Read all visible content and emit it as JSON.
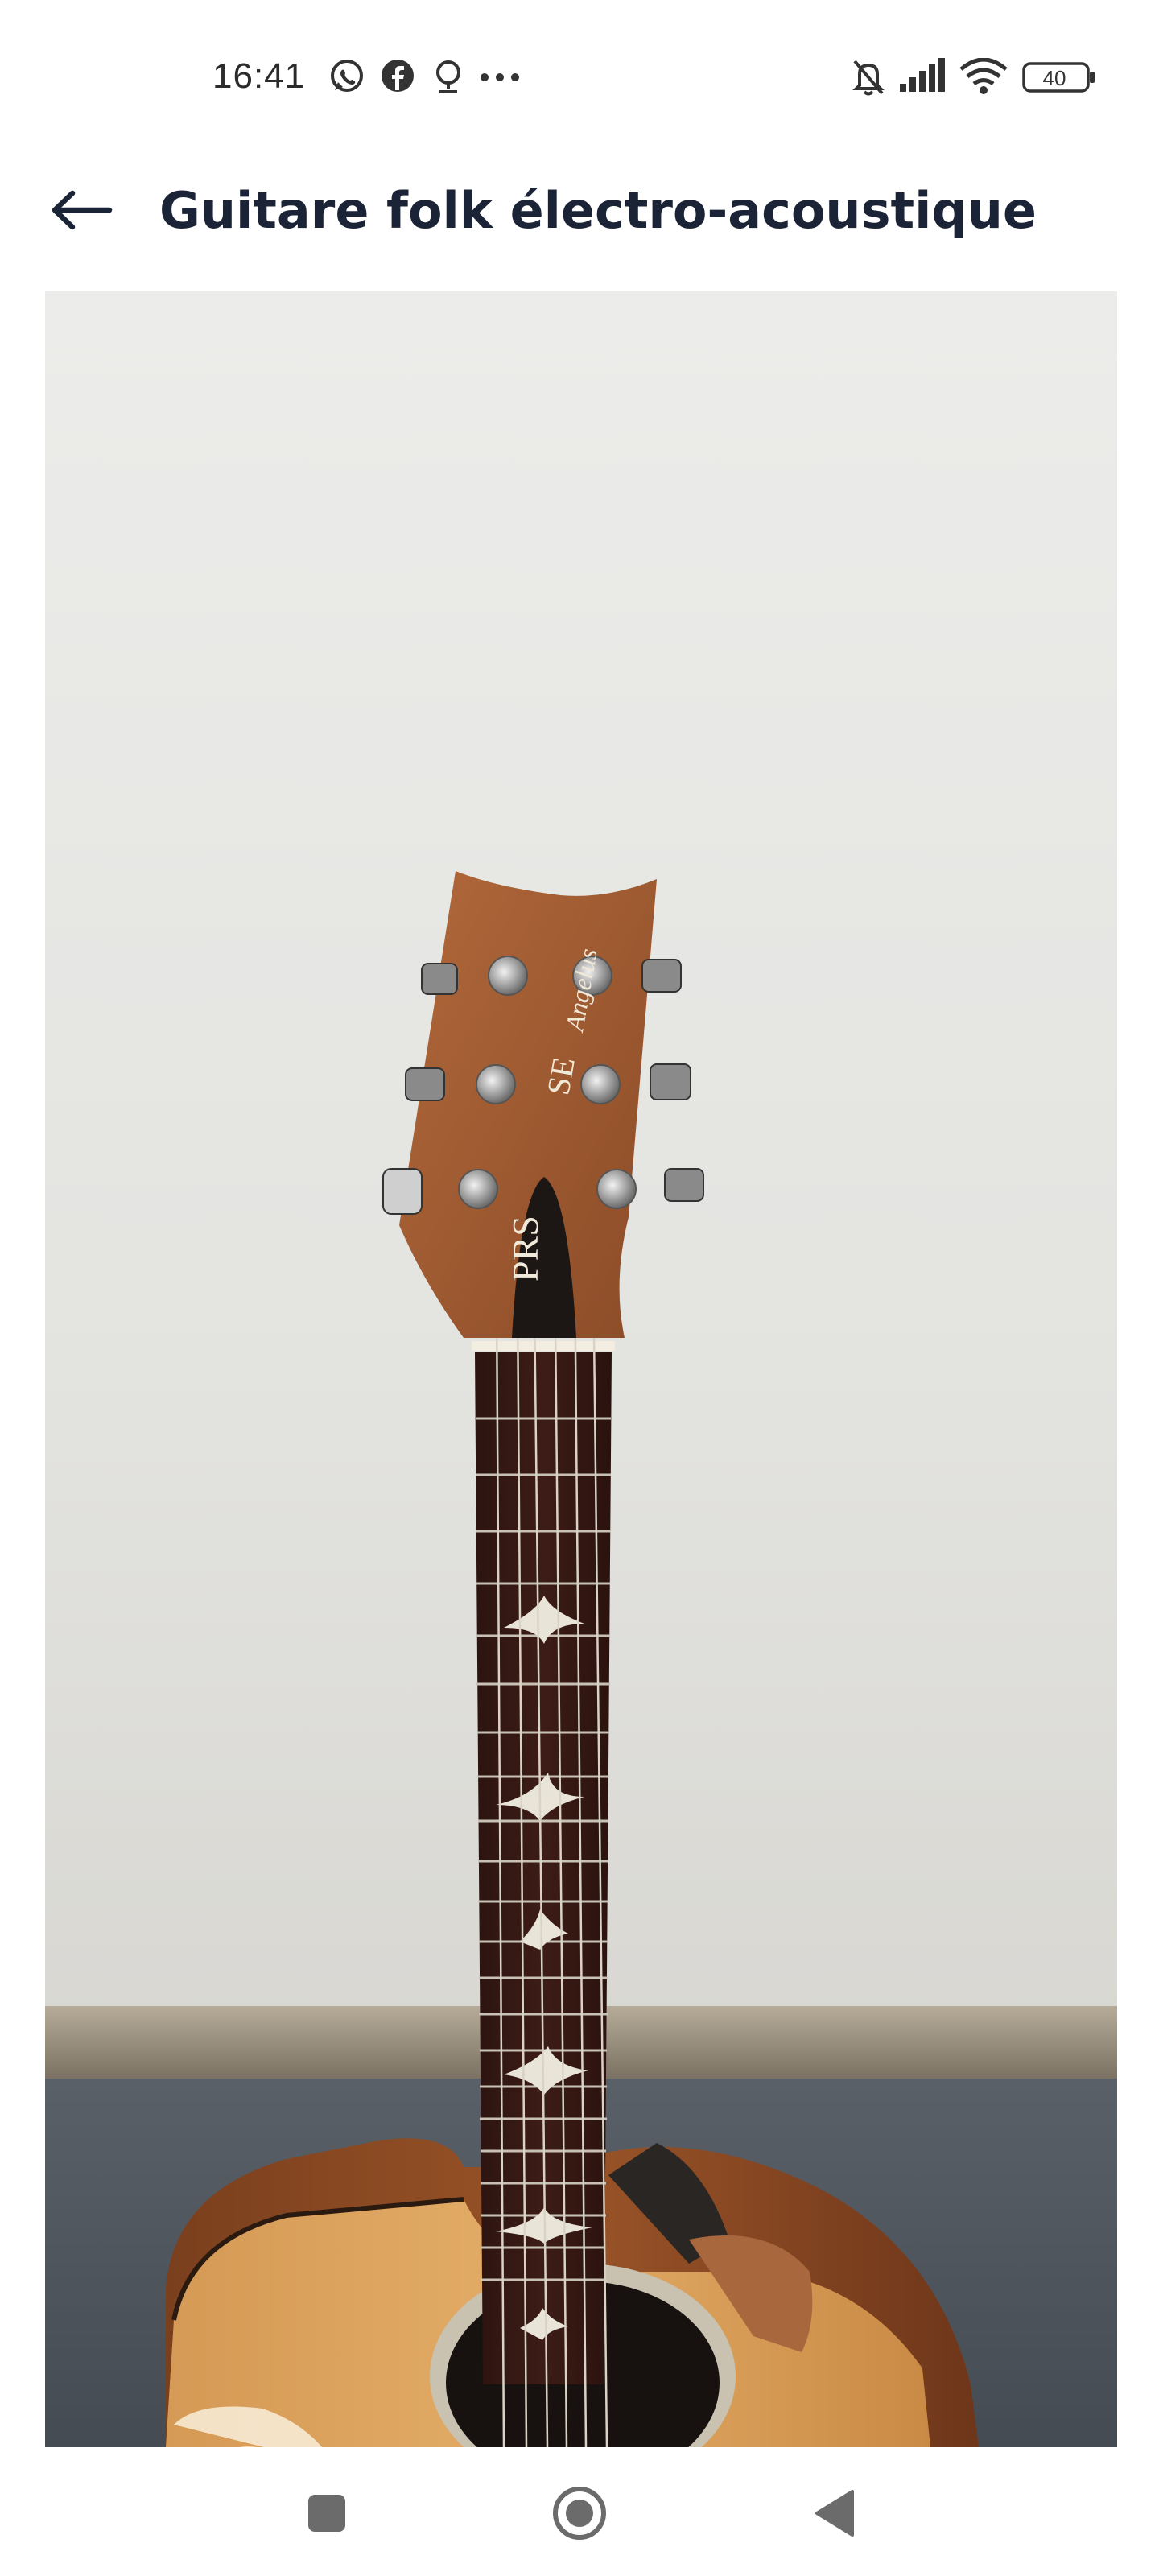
{
  "status_bar": {
    "time": "16:41",
    "notification_icons": [
      "whatsapp-icon",
      "facebook-icon",
      "location-bubble-icon",
      "more-dots-icon"
    ],
    "system_icons": [
      "mute-bell-icon",
      "signal-icon",
      "wifi-icon",
      "battery-icon"
    ],
    "battery_level": "40"
  },
  "app_bar": {
    "back_icon": "arrow-left-icon",
    "title": "Guitare folk électro-acoustique"
  },
  "photo": {
    "alt": "Guitare folk électro-acoustique",
    "headstock_logo": "PRS",
    "headstock_model": "SE",
    "headstock_signature": "Angelus"
  },
  "nav_bar": {
    "buttons": [
      "recents-square-icon",
      "home-circle-icon",
      "back-triangle-icon"
    ]
  }
}
